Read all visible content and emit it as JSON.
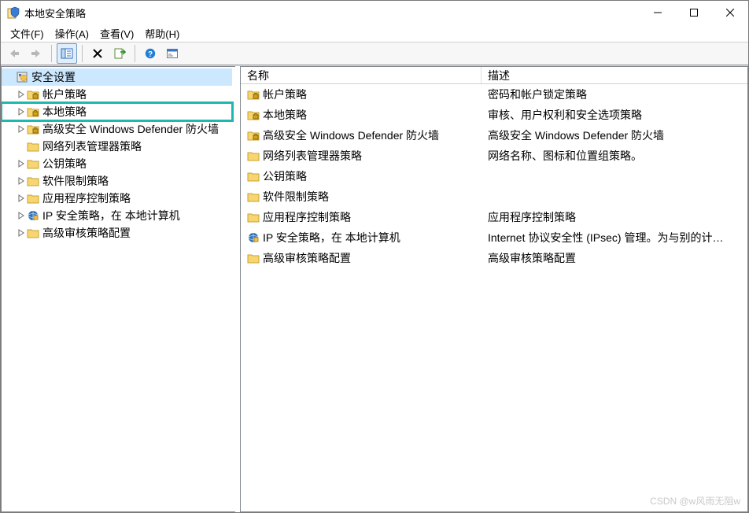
{
  "window": {
    "title": "本地安全策略"
  },
  "menu": {
    "file": "文件(F)",
    "action": "操作(A)",
    "view": "查看(V)",
    "help": "帮助(H)"
  },
  "icons": {
    "title_icon": "shield-policy-icon"
  },
  "tree": {
    "root": {
      "label": "安全设置",
      "expanded": true,
      "icon": "console-root"
    },
    "items": [
      {
        "label": "帐户策略",
        "hasChildren": true,
        "indent": 1,
        "icon": "folder-lock"
      },
      {
        "label": "本地策略",
        "hasChildren": true,
        "indent": 1,
        "icon": "folder-lock",
        "highlight": true
      },
      {
        "label": "高级安全 Windows Defender 防火墙",
        "hasChildren": true,
        "indent": 1,
        "icon": "folder-lock"
      },
      {
        "label": "网络列表管理器策略",
        "hasChildren": false,
        "indent": 1,
        "icon": "folder"
      },
      {
        "label": "公钥策略",
        "hasChildren": true,
        "indent": 1,
        "icon": "folder"
      },
      {
        "label": "软件限制策略",
        "hasChildren": true,
        "indent": 1,
        "icon": "folder"
      },
      {
        "label": "应用程序控制策略",
        "hasChildren": true,
        "indent": 1,
        "icon": "folder"
      },
      {
        "label": "IP 安全策略，在 本地计算机",
        "hasChildren": true,
        "indent": 1,
        "icon": "ipsec"
      },
      {
        "label": "高级审核策略配置",
        "hasChildren": true,
        "indent": 1,
        "icon": "folder"
      }
    ]
  },
  "details": {
    "columns": {
      "name": "名称",
      "desc": "描述"
    },
    "rows": [
      {
        "name": "帐户策略",
        "desc": "密码和帐户锁定策略",
        "icon": "folder-lock"
      },
      {
        "name": "本地策略",
        "desc": "审核、用户权利和安全选项策略",
        "icon": "folder-lock"
      },
      {
        "name": "高级安全 Windows Defender 防火墙",
        "desc": "高级安全 Windows Defender 防火墙",
        "icon": "folder-lock"
      },
      {
        "name": "网络列表管理器策略",
        "desc": "网络名称、图标和位置组策略。",
        "icon": "folder"
      },
      {
        "name": "公钥策略",
        "desc": "",
        "icon": "folder"
      },
      {
        "name": "软件限制策略",
        "desc": "",
        "icon": "folder"
      },
      {
        "name": "应用程序控制策略",
        "desc": "应用程序控制策略",
        "icon": "folder"
      },
      {
        "name": "IP 安全策略，在 本地计算机",
        "desc": "Internet 协议安全性 (IPsec) 管理。为与别的计…",
        "icon": "ipsec"
      },
      {
        "name": "高级审核策略配置",
        "desc": "高级审核策略配置",
        "icon": "folder"
      }
    ]
  },
  "watermark": "CSDN @w风雨无阻w"
}
